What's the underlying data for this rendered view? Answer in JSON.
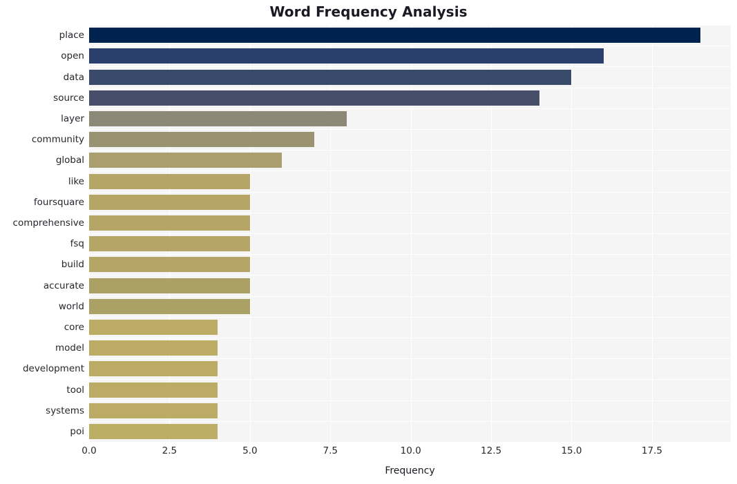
{
  "chart_data": {
    "type": "bar",
    "orientation": "horizontal",
    "title": "Word Frequency Analysis",
    "xlabel": "Frequency",
    "ylabel": "",
    "xlim": [
      0,
      19.95
    ],
    "xticks": [
      "0.0",
      "2.5",
      "5.0",
      "7.5",
      "10.0",
      "12.5",
      "15.0",
      "17.5"
    ],
    "xtick_values": [
      0,
      2.5,
      5,
      7.5,
      10,
      12.5,
      15,
      17.5
    ],
    "grid": true,
    "legend": false,
    "categories": [
      "place",
      "open",
      "data",
      "source",
      "layer",
      "community",
      "global",
      "like",
      "foursquare",
      "comprehensive",
      "fsq",
      "build",
      "accurate",
      "world",
      "core",
      "model",
      "development",
      "tool",
      "systems",
      "poi"
    ],
    "values": [
      19,
      16,
      15,
      14,
      8,
      7,
      6,
      5,
      5,
      5,
      5,
      5,
      5,
      5,
      4,
      4,
      4,
      4,
      4,
      4
    ],
    "colors": [
      "#00224e",
      "#2a3f6c",
      "#3a4a6b",
      "#474e69",
      "#8b8878",
      "#9a9372",
      "#aa9e6f",
      "#b5a668",
      "#b5a668",
      "#b5a668",
      "#b5a668",
      "#b5a668",
      "#aca165",
      "#aca165",
      "#bbab64",
      "#bbab64",
      "#bbab64",
      "#bbab64",
      "#bbab64",
      "#bcae64"
    ],
    "background_color": "#f5f5f6",
    "figure_color": "#ffffff",
    "gridline_color": "#ffffff",
    "title_color": "#1a1a22",
    "tick_color": "#26262c"
  }
}
